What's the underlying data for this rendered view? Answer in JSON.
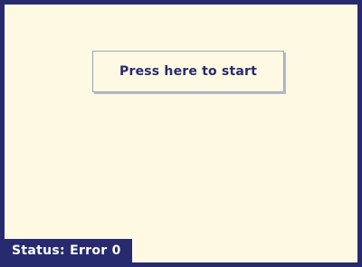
{
  "screen": {
    "start_button_label": "Press here to start",
    "status_text": "Status: Error 0"
  },
  "colors": {
    "background": "#fdf9e3",
    "frame": "#272a6f",
    "text": "#272a6f",
    "status_text": "#ffffff"
  }
}
